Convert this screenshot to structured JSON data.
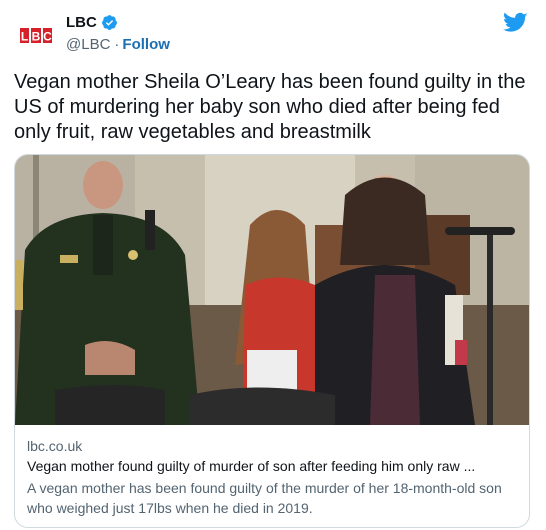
{
  "account": {
    "display_name": "LBC",
    "handle": "@LBC",
    "separator": "·",
    "follow_label": "Follow",
    "logo_text": "LBC",
    "avatar_icon": "lbc-logo-icon",
    "verified_icon": "verified-badge-icon",
    "platform_icon": "twitter-bird-icon"
  },
  "tweet": {
    "text": "Vegan mother Sheila O’Leary has been found guilty in the US of murdering her baby son who died after being fed only fruit, raw vegetables and breastmilk"
  },
  "card": {
    "domain": "lbc.co.uk",
    "title": "Vegan mother found guilty of murder of son after feeding him only raw ...",
    "description": "A vegan mother has been found guilty of the murder of her 18-month-old son who weighed just 17lbs when he died in 2019."
  },
  "colors": {
    "brand_blue": "#1d9bf0",
    "follow_blue": "#1b6fb3",
    "lbc_red": "#d6202a",
    "text_primary": "#0f1419",
    "text_secondary": "#536471",
    "border": "#cfd9de"
  }
}
